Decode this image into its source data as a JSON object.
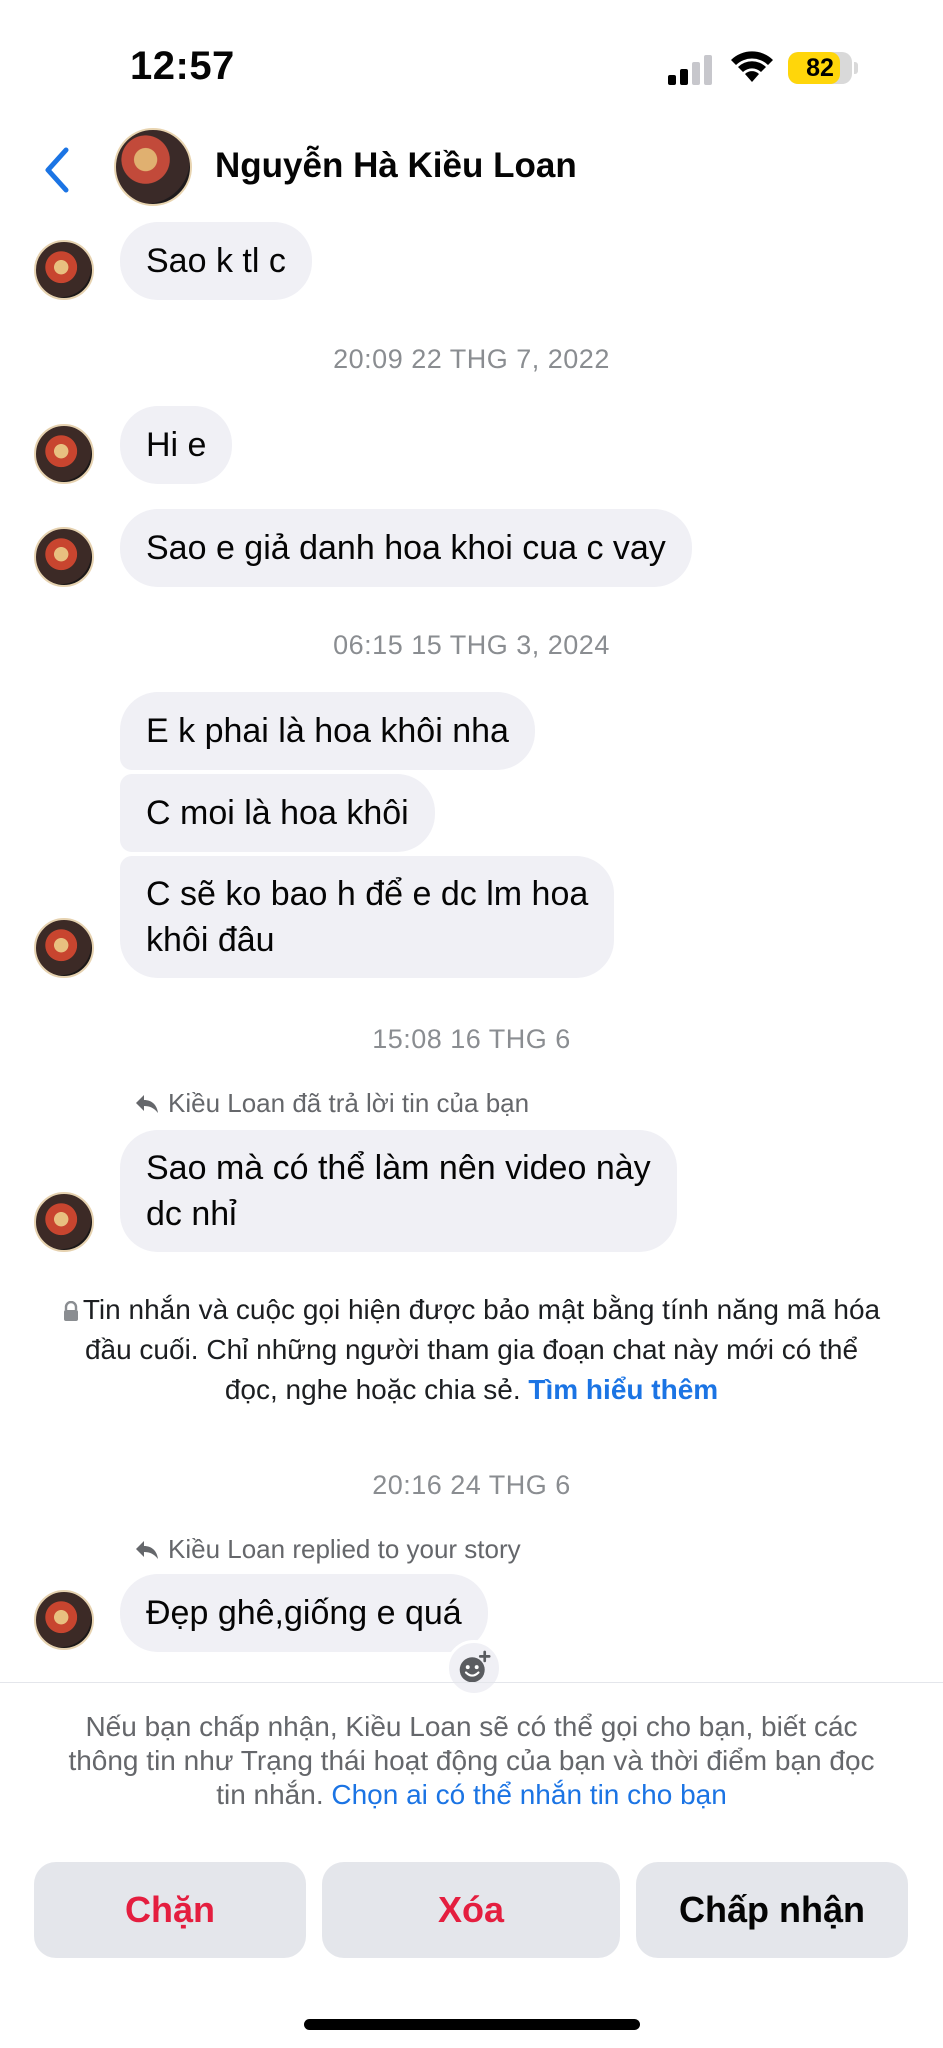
{
  "status_bar": {
    "time": "12:57",
    "battery_percent": 82
  },
  "header": {
    "contact_name": "Nguyễn Hà Kiều Loan"
  },
  "messages": {
    "m1": "Sao k tl c",
    "ts1": "20:09 22 THG 7, 2022",
    "m2": "Hi e",
    "m3": "Sao e giả danh hoa khoi cua c vay",
    "ts2": "06:15 15 THG 3, 2024",
    "m4": "E k phai là hoa khôi nha",
    "m5": "C moi là hoa khôi",
    "m6a": "C sẽ ko bao h để e dc lm hoa",
    "m6b": "khôi đâu",
    "ts3": "15:08 16 THG 6",
    "reply_note_1": "Kiều Loan đã trả lời tin của bạn",
    "m7a": "Sao mà có thể làm nên video này",
    "m7b": "dc nhỉ",
    "ts4": "20:16 24 THG 6",
    "reply_note_2": "Kiều Loan replied to your story",
    "m8": "Đẹp ghê,giống e quá"
  },
  "e2e_notice": {
    "line1": "Tin nhắn và cuộc gọi hiện được bảo mật bằng tính năng mã hóa",
    "line2": "đầu cuối. Chỉ những người tham gia đoạn chat này mới có thể",
    "line3_text": "đọc, nghe hoặc chia sẻ.",
    "link": "Tìm hiểu thêm"
  },
  "request_notice": {
    "line1": "Nếu bạn chấp nhận, Kiều Loan sẽ có thể gọi cho bạn, biết các",
    "line2": "thông tin như Trạng thái hoạt động của bạn và thời điểm bạn đọc",
    "line3_text": "tin nhắn.",
    "link": "Chọn ai có thể nhắn tin cho bạn"
  },
  "actions": {
    "block": "Chặn",
    "delete": "Xóa",
    "accept": "Chấp nhận"
  },
  "colors": {
    "accent": "#1b74e4",
    "danger": "#e41e3f",
    "bubble": "#f0f0f5",
    "battery": "#ffd60a"
  }
}
